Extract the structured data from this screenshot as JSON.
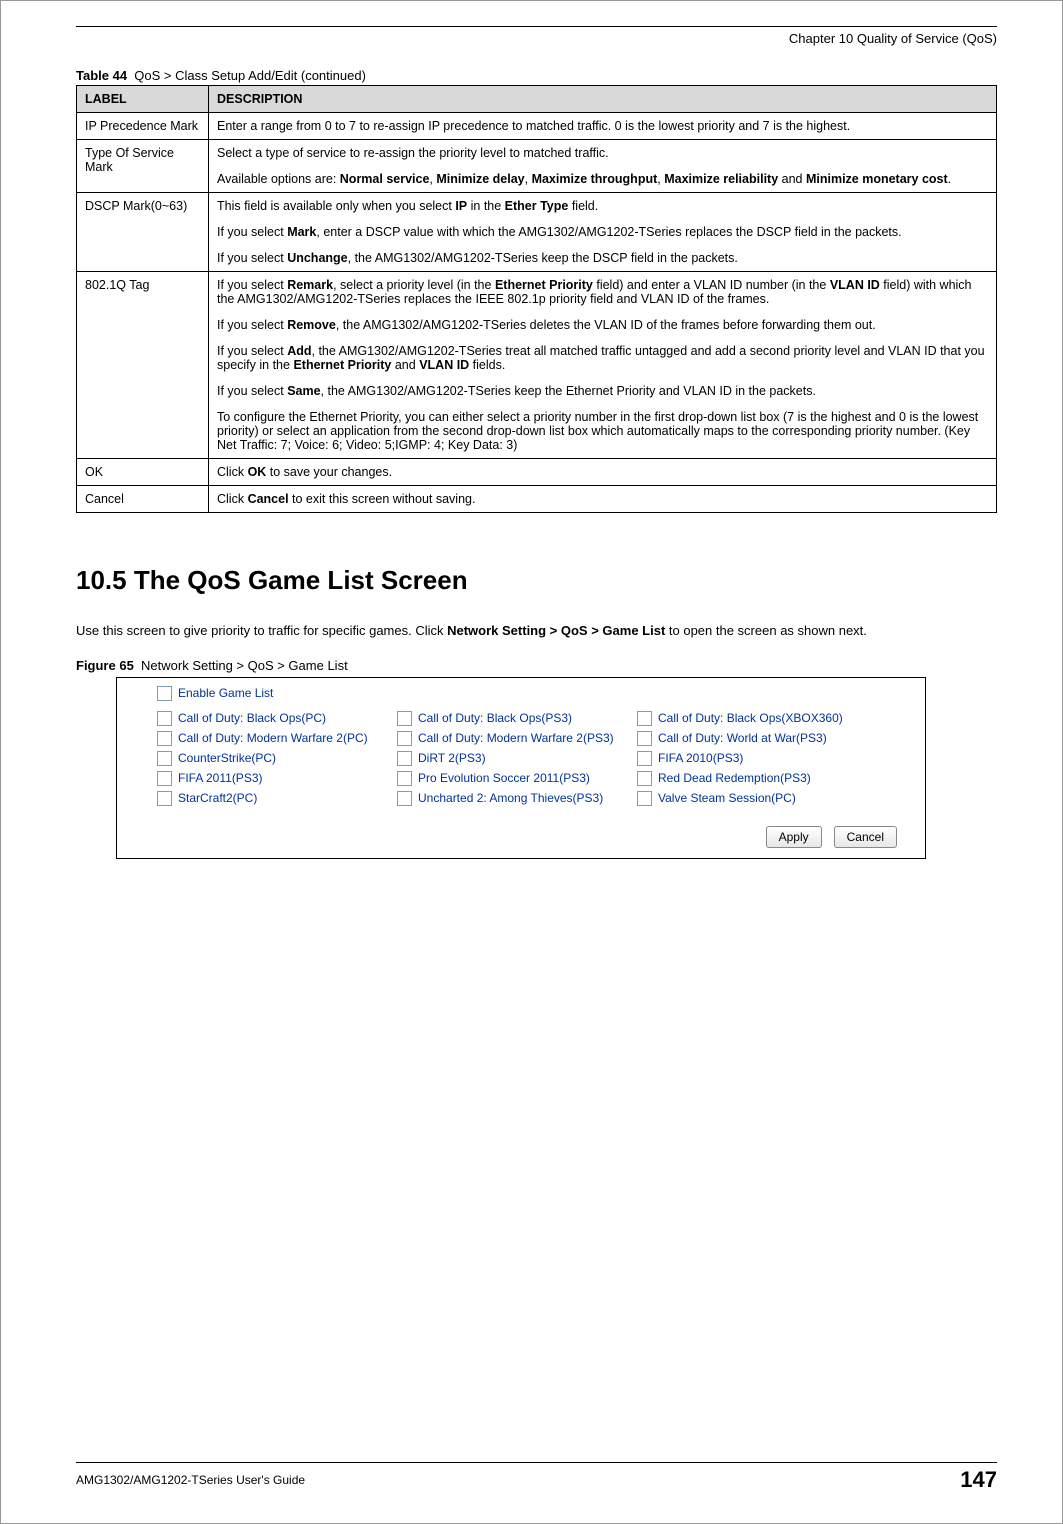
{
  "header": {
    "chapter_line": "Chapter 10 Quality of Service (QoS)"
  },
  "table": {
    "caption_label": "Table 44",
    "caption_text": "QoS > Class Setup Add/Edit (continued)",
    "header_label": "LABEL",
    "header_desc": "DESCRIPTION",
    "rows": {
      "ip_precedence": {
        "label": "IP Precedence Mark",
        "desc": "Enter a range from 0 to 7 to re-assign IP precedence to matched traffic. 0 is the lowest priority and 7 is the highest."
      },
      "type_of_service": {
        "label": "Type Of Service Mark",
        "p1": "Select a type of service to re-assign the priority level to matched traffic.",
        "p2_pre": "Available options are: ",
        "p2_b1": "Normal service",
        "p2_sep": ", ",
        "p2_b2": "Minimize delay",
        "p2_b3": "Maximize throughput",
        "p2_b4": "Maximize reliability",
        "p2_and": " and ",
        "p2_b5": "Minimize monetary cost",
        "p2_end": "."
      },
      "dscp": {
        "label": "DSCP Mark(0~63)",
        "p1_pre": "This field is available only when you select ",
        "p1_b1": "IP",
        "p1_mid": " in the ",
        "p1_b2": "Ether Type",
        "p1_post": " field.",
        "p2_pre": "If you select ",
        "p2_b1": "Mark",
        "p2_post": ", enter a DSCP value with which the AMG1302/AMG1202-TSeries replaces the DSCP field in the packets.",
        "p3_pre": "If you select ",
        "p3_b1": "Unchange",
        "p3_post": ", the AMG1302/AMG1202-TSeries keep the DSCP field in the packets."
      },
      "tag": {
        "label": "802.1Q Tag",
        "p1_pre": "If you select ",
        "p1_b1": "Remark",
        "p1_mid1": ", select a priority level (in the ",
        "p1_b2": "Ethernet Priority",
        "p1_mid2": " field) and enter a VLAN ID number (in the ",
        "p1_b3": "VLAN ID",
        "p1_post": " field) with which the AMG1302/AMG1202-TSeries replaces the IEEE 802.1p priority field and VLAN ID of the frames.",
        "p2_pre": "If you select ",
        "p2_b1": "Remove",
        "p2_post": ", the AMG1302/AMG1202-TSeries deletes the VLAN ID of the frames before forwarding them out.",
        "p3_pre": "If you select ",
        "p3_b1": "Add",
        "p3_mid1": ", the AMG1302/AMG1202-TSeries treat all matched traffic untagged and add a second priority level and VLAN ID that you specify in the ",
        "p3_b2": "Ethernet Priority",
        "p3_mid2": " and ",
        "p3_b3": "VLAN ID",
        "p3_post": " fields.",
        "p4_pre": "If you select ",
        "p4_b1": "Same",
        "p4_post": ", the AMG1302/AMG1202-TSeries keep the Ethernet Priority and VLAN ID in the packets.",
        "p5": "To configure the Ethernet Priority, you can either select a priority number in the first drop-down list box (7 is the highest and 0 is the lowest priority) or select an application from the second drop-down list box which automatically maps to the corresponding priority number. (Key Net Traffic: 7; Voice: 6; Video: 5;IGMP: 4; Key Data: 3)"
      },
      "ok": {
        "label": "OK",
        "pre": "Click ",
        "b1": "OK",
        "post": " to save your changes."
      },
      "cancel": {
        "label": "Cancel",
        "pre": "Click ",
        "b1": "Cancel",
        "post": " to exit this screen without saving."
      }
    }
  },
  "section": {
    "heading": "10.5  The QoS Game List Screen",
    "body_pre": "Use this screen to give priority to traffic for specific games. Click ",
    "body_b1": "Network Setting > QoS > Game List",
    "body_post": " to open the screen as shown next."
  },
  "figure": {
    "caption_label": "Figure 65",
    "caption_text": "Network Setting > QoS > Game List",
    "master_label": "Enable Game List",
    "games": [
      "Call of Duty: Black Ops(PC)",
      "Call of Duty: Black Ops(PS3)",
      "Call of Duty: Black Ops(XBOX360)",
      "Call of Duty: Modern Warfare 2(PC)",
      "Call of Duty: Modern Warfare 2(PS3)",
      "Call of Duty: World at War(PS3)",
      "CounterStrike(PC)",
      "DiRT 2(PS3)",
      "FIFA 2010(PS3)",
      "FIFA 2011(PS3)",
      "Pro Evolution Soccer 2011(PS3)",
      "Red Dead Redemption(PS3)",
      "StarCraft2(PC)",
      "Uncharted 2: Among Thieves(PS3)",
      "Valve Steam Session(PC)"
    ],
    "apply_label": "Apply",
    "cancel_label": "Cancel"
  },
  "footer": {
    "guide": "AMG1302/AMG1202-TSeries User's Guide",
    "page": "147"
  }
}
